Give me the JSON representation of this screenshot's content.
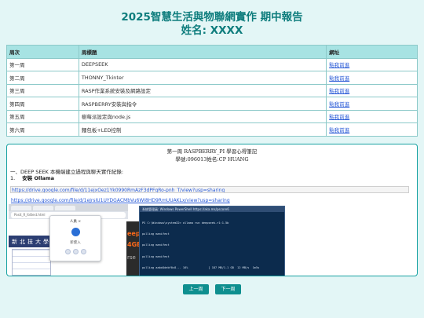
{
  "header": {
    "title": "2025智慧生活與物聯網實作 期中報告",
    "name_line": "姓名: XXXX"
  },
  "table": {
    "headers": [
      "周次",
      "周標題",
      "網址"
    ],
    "rows": [
      {
        "week": "第一周",
        "title": "DEEPSEEK",
        "link": "點我前進"
      },
      {
        "week": "第二周",
        "title": "THONNY_Tkinter",
        "link": "點我前進"
      },
      {
        "week": "第三周",
        "title": "RASP作業系統安裝及網路設定",
        "link": "點我前進"
      },
      {
        "week": "第四周",
        "title": "RASPBERRY安裝與指令",
        "link": "點我前進"
      },
      {
        "week": "第五周",
        "title": "樹莓派設定與node.js",
        "link": "點我前進"
      },
      {
        "week": "第六周",
        "title": "麵包板+LED控制",
        "link": "點我前進"
      }
    ]
  },
  "panel": {
    "title_line1": "第一周 RASPBERRY_PI 學習心得筆記",
    "title_line2": "學號:096013姓名:CP HUANG",
    "intro": "一、DEEP SEEK 本機端建立過程與聊天實作紀錄:",
    "step_num": "1.",
    "step_label": "安裝 Ollama",
    "link1": "https://drive.google.com/file/d/11ejxOez1Yk0990RmAzF3dPFqRo-pnh_T/view?usp=sharing",
    "link2": "https://drive.google.com/file/d/1eJrsIU1UYDGACMbVu6WI8HD9RmUUAKLx/view?usp=sharing"
  },
  "screenshot": {
    "browser_address": "Posit_R_ltdtest.html",
    "site_banner": "新北技大學",
    "dialog_title": "人員 ×",
    "dialog_name": "新使入",
    "overlay_text_1": "eep",
    "overlay_text_2": "4GB",
    "overlay_text_3": "rse",
    "terminal_title": "系統管理員: Windows PowerShell  https://aka.ms/pscore6",
    "terminal_lines": [
      "PS C:\\Windows\\system32> ollama run deepseek-r1:1.5b",
      "pulling manifest",
      "pulling manifest",
      "pulling manifest",
      "pulling aabd4debf0c8... 16%            ] 187 MB/1.1 GB  12 MB/s  1m5s"
    ]
  },
  "nav": {
    "prev": "上一周",
    "next": "下一周"
  },
  "colors": {
    "background": "#e3f6f6",
    "accent": "#0e8f8f",
    "title": "#0e7d7d",
    "table_header": "#a7e3e3",
    "link": "#2a5bd7"
  }
}
